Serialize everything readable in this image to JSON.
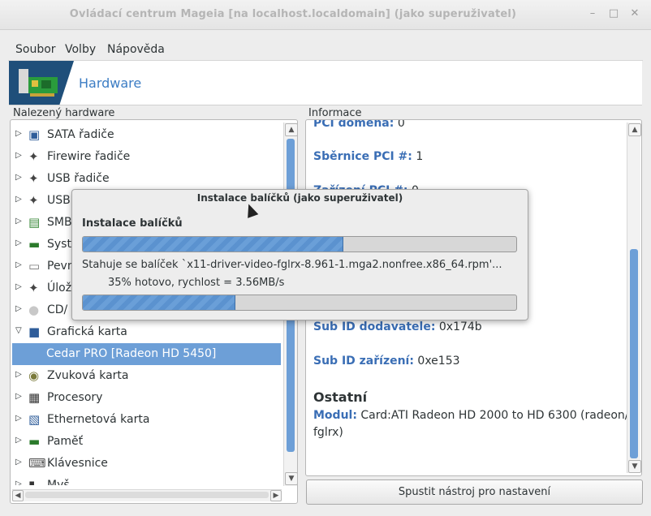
{
  "window": {
    "title": "Ovládací centrum Mageia  [na localhost.localdomain] (jako superuživatel)",
    "minimize_icon": "minimize-icon",
    "maximize_icon": "maximize-icon",
    "close_icon": "close-icon"
  },
  "menubar": {
    "items": [
      {
        "label": "Soubor"
      },
      {
        "label": "Volby"
      },
      {
        "label": "Nápověda"
      }
    ]
  },
  "banner": {
    "title": "Hardware",
    "icon": "hardware-card-icon"
  },
  "tree": {
    "label": "Nalezený hardware",
    "items": [
      {
        "label": "SATA řadiče",
        "icon": "disk-controller-icon",
        "expanded": false
      },
      {
        "label": "Firewire řadiče",
        "icon": "plug-icon",
        "expanded": false
      },
      {
        "label": "USB řadiče",
        "icon": "plug-icon",
        "expanded": false
      },
      {
        "label": "USB",
        "icon": "plug-icon",
        "expanded": false
      },
      {
        "label": "SMB",
        "icon": "board-icon",
        "expanded": false
      },
      {
        "label": "Syst",
        "icon": "memory-icon",
        "expanded": false
      },
      {
        "label": "Pevn",
        "icon": "hard-disk-icon",
        "expanded": false
      },
      {
        "label": "Úlož",
        "icon": "plug-icon",
        "expanded": false
      },
      {
        "label": "CD/",
        "icon": "cd-icon",
        "expanded": false
      },
      {
        "label": "Grafická karta",
        "icon": "monitor-icon",
        "expanded": true
      },
      {
        "label": "Cedar PRO [Radeon HD 5450]",
        "icon": "",
        "selected": true
      },
      {
        "label": "Zvuková karta",
        "icon": "sound-card-icon",
        "expanded": false
      },
      {
        "label": "Procesory",
        "icon": "cpu-icon",
        "expanded": false
      },
      {
        "label": "Ethernetová karta",
        "icon": "network-icon",
        "expanded": false
      },
      {
        "label": "Paměť",
        "icon": "memory-icon",
        "expanded": false
      },
      {
        "label": "Klávesnice",
        "icon": "keyboard-icon",
        "expanded": false
      },
      {
        "label": "Myš",
        "icon": "mouse-icon",
        "expanded": false
      }
    ]
  },
  "info": {
    "label": "Informace",
    "fields": [
      {
        "key": "PCI doména:",
        "value": "0"
      },
      {
        "key": "Sběrnice PCI #:",
        "value": "1"
      },
      {
        "key": "Zařízení PCI #:",
        "value": "0"
      },
      {
        "key": "Sub ID dodavatele:",
        "value": "0x174b"
      },
      {
        "key": "Sub ID zařízení:",
        "value": "0xe153"
      }
    ],
    "section_title": "Ostatní",
    "module_key": "Modul:",
    "module_value_line1": "Card:ATI Radeon HD 2000 to HD 6300 (radeon/",
    "module_value_line2": "fglrx)"
  },
  "dialog": {
    "title": "Instalace balíčků (jako superuživatel)",
    "heading": "Instalace balíčků",
    "overall_progress": 0.6,
    "status": "Stahuje se balíček `x11-driver-video-fglrx-8.961-1.mga2.nonfree.x86_64.rpm'...",
    "percent_text": "35% hotovo, rychlost = 3.56MB/s",
    "file_progress": 0.35
  },
  "action_button": "Spustit nástroj pro nastavení"
}
